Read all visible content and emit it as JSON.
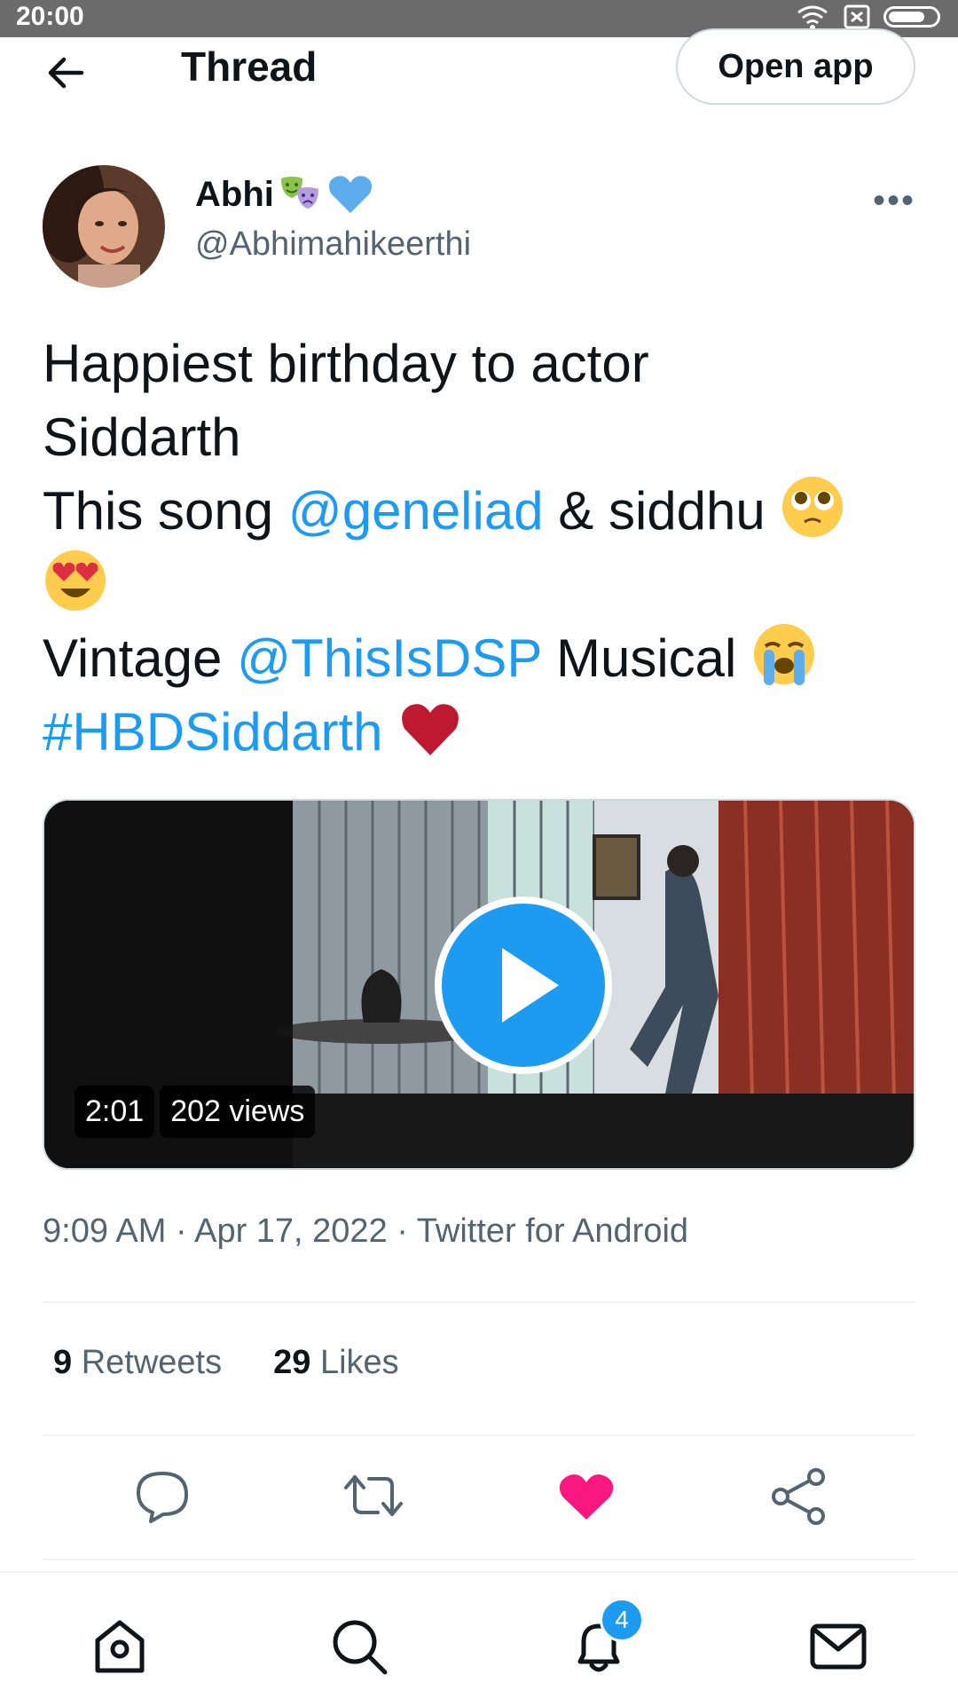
{
  "status_bar": {
    "time": "20:00"
  },
  "header": {
    "title": "Thread",
    "open_app_label": "Open app"
  },
  "tweet": {
    "author_name": "Abhi",
    "author_handle": "@Abhimahikeerthi",
    "line1": "Happiest birthday to actor",
    "line2": "Siddarth",
    "line3_a": "This song ",
    "mention1": "@geneliad",
    "line3_b": " & siddhu ",
    "line5_a": "Vintage ",
    "mention2": "@ThisIsDSP",
    "line5_b": " Musical ",
    "hashtag": "#HBDSiddarth",
    "emojis": [
      "pleading-face",
      "heart-eyes-face",
      "loudly-crying-face",
      "red-heart"
    ],
    "video": {
      "duration": "2:01",
      "views": "202 views"
    },
    "meta": "9:09 AM · Apr 17, 2022 · Twitter for Android"
  },
  "stats": {
    "retweets_count": "9",
    "retweets_label": "Retweets",
    "likes_count": "29",
    "likes_label": "Likes"
  },
  "actions": [
    "reply-icon",
    "retweet-icon",
    "like-icon",
    "share-icon"
  ],
  "bottom_nav": {
    "items": [
      "home-icon",
      "search-icon",
      "notifications-icon",
      "messages-icon"
    ],
    "notification_count": "4"
  },
  "colors": {
    "link": "#1d9bf0",
    "like": "#f91880",
    "text": "#0f1419",
    "secondary": "#536471"
  }
}
